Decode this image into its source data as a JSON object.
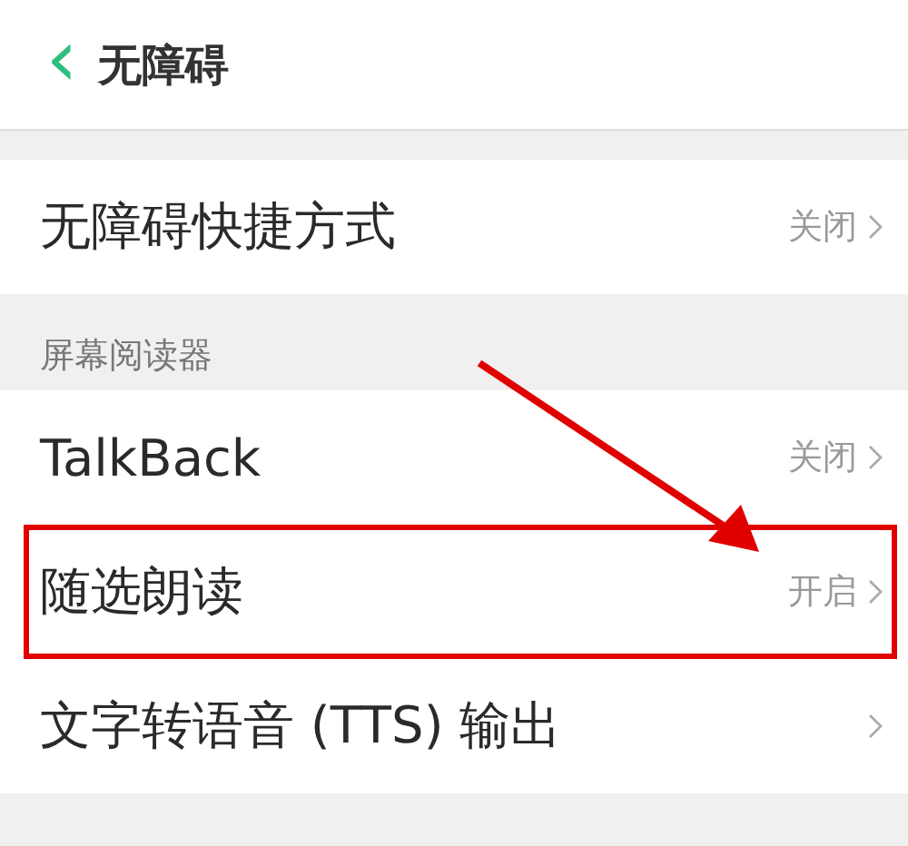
{
  "header": {
    "back": "‹",
    "title": "无障碍"
  },
  "sections": [
    {
      "items": [
        {
          "label": "无障碍快捷方式",
          "value": "关闭",
          "highlighted": false
        }
      ]
    },
    {
      "header": "屏幕阅读器",
      "items": [
        {
          "label": "TalkBack",
          "value": "关闭",
          "highlighted": false
        },
        {
          "label": "随选朗读",
          "value": "开启",
          "highlighted": true
        },
        {
          "label": "文字转语音 (TTS) 输出",
          "highlighted": false
        }
      ]
    }
  ]
}
